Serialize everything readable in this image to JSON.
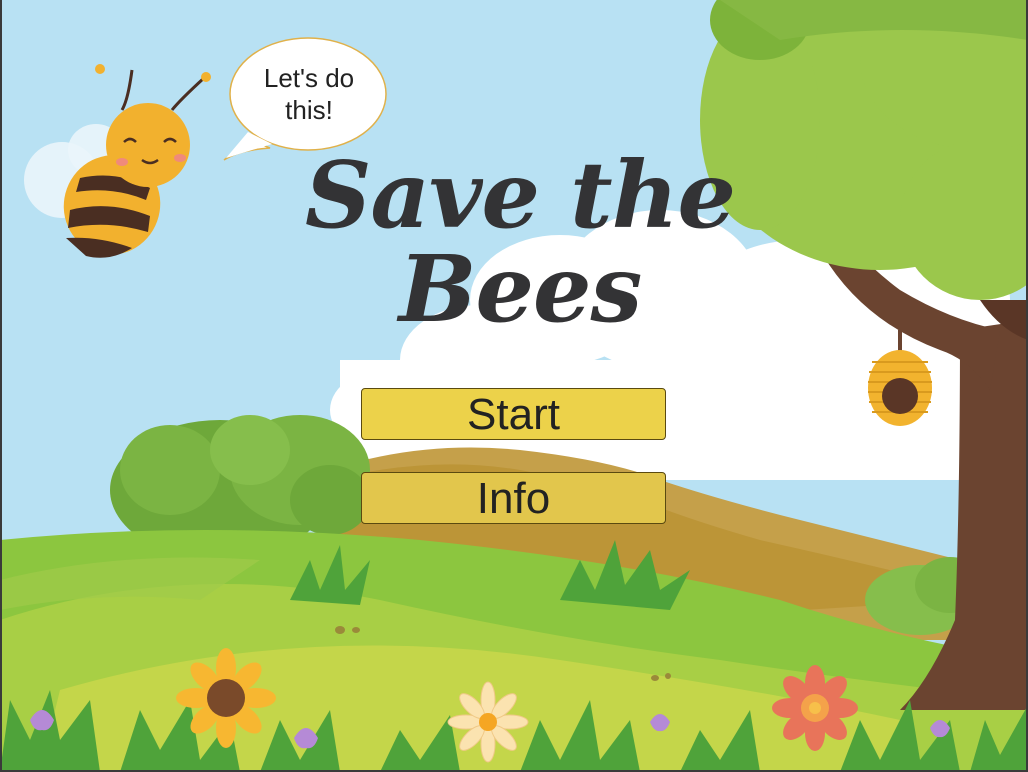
{
  "scene": {
    "sky_color": "#b8e1f3",
    "grass_color": "#8cc63f",
    "hill_color": "#c5a04a",
    "tree_trunk_color": "#6b4430",
    "tree_leaf_color": "#9bc74c"
  },
  "speech_bubble": {
    "text_line1": "Let's do",
    "text_line2": "this!"
  },
  "title": {
    "line1": "Save the",
    "line2": "Bees",
    "color": "#333335"
  },
  "menu": {
    "start_label": "Start",
    "info_label": "Info",
    "start_color": "#ecd24a",
    "info_color": "#e2c64c"
  },
  "icons": [
    "bee-icon",
    "beehive-icon",
    "sunflower-icon",
    "daisy-icon",
    "orange-flower-icon",
    "purple-bud-icon",
    "tree-icon",
    "bush-icon",
    "grass-tuft-icon",
    "cloud-icon"
  ]
}
